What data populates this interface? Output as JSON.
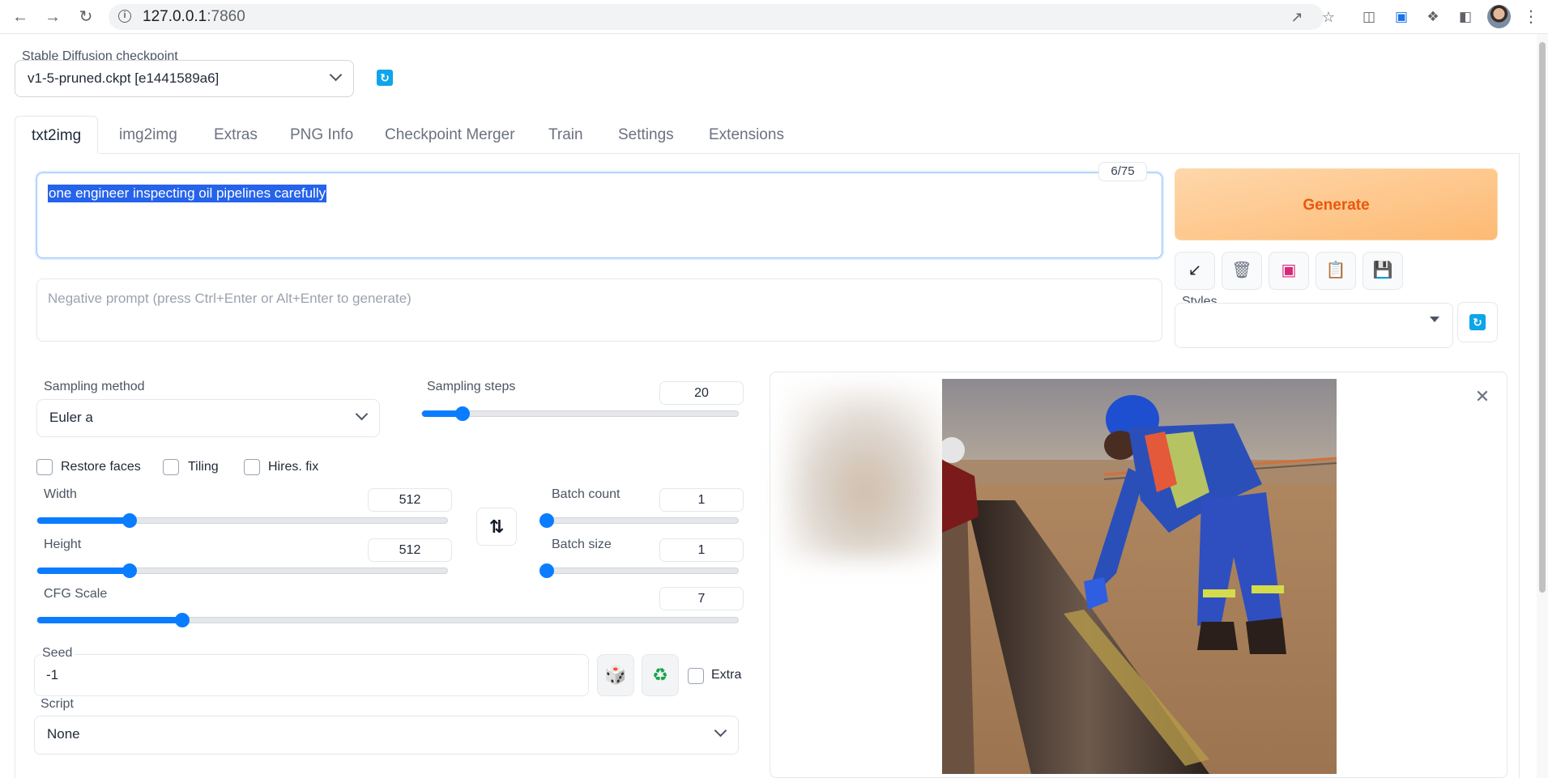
{
  "browser": {
    "url_host": "127.0.0.1",
    "url_port": ":7860",
    "info_icon": "i"
  },
  "checkpoint": {
    "label": "Stable Diffusion checkpoint",
    "value": "v1-5-pruned.ckpt [e1441589a6]"
  },
  "tabs": [
    {
      "label": "txt2img",
      "active": true
    },
    {
      "label": "img2img"
    },
    {
      "label": "Extras"
    },
    {
      "label": "PNG Info"
    },
    {
      "label": "Checkpoint Merger"
    },
    {
      "label": "Train"
    },
    {
      "label": "Settings"
    },
    {
      "label": "Extensions"
    }
  ],
  "prompt": {
    "value": "one engineer inspecting oil pipelines carefully",
    "token_count": "6/75",
    "negative_placeholder": "Negative prompt (press Ctrl+Enter or Alt+Enter to generate)"
  },
  "generate": {
    "label": "Generate"
  },
  "styles": {
    "label": "Styles"
  },
  "sampling": {
    "method_label": "Sampling method",
    "method_value": "Euler a",
    "steps_label": "Sampling steps",
    "steps_value": "20",
    "steps_min": 1,
    "steps_max": 150
  },
  "checkboxes": {
    "restore_faces": "Restore faces",
    "tiling": "Tiling",
    "hires_fix": "Hires. fix",
    "extra": "Extra"
  },
  "size": {
    "width_label": "Width",
    "width_value": "512",
    "height_label": "Height",
    "height_value": "512",
    "min": 64,
    "max": 2048
  },
  "batch": {
    "count_label": "Batch count",
    "count_value": "1",
    "size_label": "Batch size",
    "size_value": "1",
    "count_max": 100,
    "size_max": 8
  },
  "cfg": {
    "label": "CFG Scale",
    "value": "7",
    "min": 1,
    "max": 30
  },
  "seed": {
    "label": "Seed",
    "value": "-1"
  },
  "script": {
    "label": "Script",
    "value": "None"
  },
  "colors": {
    "accent": "#0a7cff",
    "generate_bg": "#fdba74",
    "generate_text": "#ea580c",
    "selection": "#2563eb"
  }
}
